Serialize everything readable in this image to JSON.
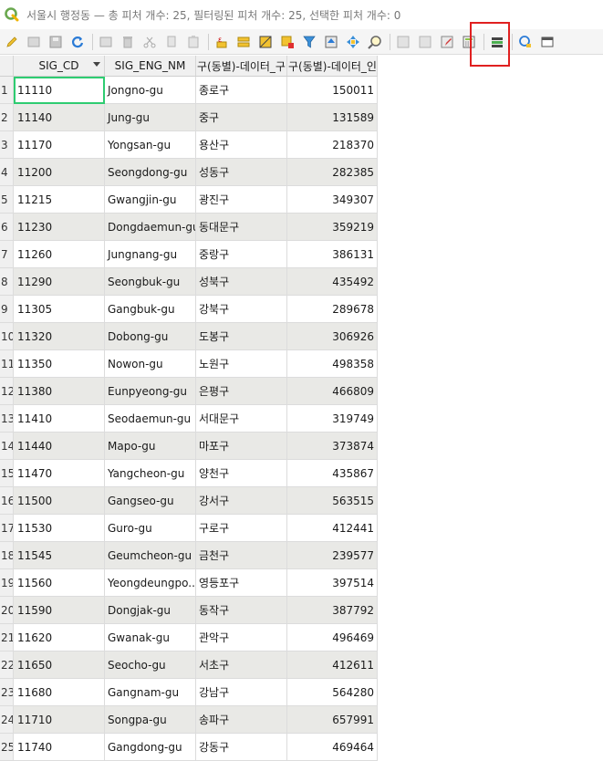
{
  "window": {
    "title": "서울시 행정동 — 총 피처 개수: 25, 필터링된 피처 개수: 25, 선택한 피처 개수: 0"
  },
  "toolbar": {
    "buttons": [
      {
        "name": "toggle-editing-button",
        "icon": "pencil-icon"
      },
      {
        "name": "multi-edit-button",
        "icon": "multi-edit-icon"
      },
      {
        "name": "save-edits-button",
        "icon": "save-icon"
      },
      {
        "name": "reload-button",
        "icon": "refresh-icon"
      },
      {
        "name": "add-feature-button",
        "icon": "add-feature-icon"
      },
      {
        "name": "delete-feature-button",
        "icon": "delete-icon"
      },
      {
        "name": "cut-button",
        "icon": "cut-icon"
      },
      {
        "name": "copy-button",
        "icon": "copy-icon"
      },
      {
        "name": "paste-button",
        "icon": "paste-icon"
      },
      {
        "name": "select-by-expression-button",
        "icon": "expression-select-icon"
      },
      {
        "name": "select-all-button",
        "icon": "select-all-icon"
      },
      {
        "name": "invert-selection-button",
        "icon": "invert-selection-icon"
      },
      {
        "name": "deselect-all-button",
        "icon": "deselect-icon"
      },
      {
        "name": "filter-select-button",
        "icon": "filter-icon"
      },
      {
        "name": "move-selection-top-button",
        "icon": "move-top-icon"
      },
      {
        "name": "pan-to-selection-button",
        "icon": "pan-icon"
      },
      {
        "name": "zoom-to-selection-button",
        "icon": "zoom-icon"
      },
      {
        "name": "new-field-button",
        "icon": "new-field-icon"
      },
      {
        "name": "delete-field-button",
        "icon": "delete-field-icon"
      },
      {
        "name": "organize-columns-button",
        "icon": "organize-columns-icon"
      },
      {
        "name": "field-calculator-button",
        "icon": "calculator-icon"
      },
      {
        "name": "conditional-formatting-button",
        "icon": "conditional-format-icon"
      },
      {
        "name": "actions-button",
        "icon": "actions-icon"
      },
      {
        "name": "dock-button",
        "icon": "dock-icon"
      }
    ],
    "highlight_color": "#e02020"
  },
  "table": {
    "columns": [
      "SIG_CD",
      "SIG_ENG_NM",
      "구(동별)-데이터_구",
      "구(동별)-데이터_인"
    ],
    "rows": [
      {
        "num": "1",
        "cd": "11110",
        "eng": "Jongno-gu",
        "kor": "종로구",
        "pop": "150011"
      },
      {
        "num": "2",
        "cd": "11140",
        "eng": "Jung-gu",
        "kor": "중구",
        "pop": "131589"
      },
      {
        "num": "3",
        "cd": "11170",
        "eng": "Yongsan-gu",
        "kor": "용산구",
        "pop": "218370"
      },
      {
        "num": "4",
        "cd": "11200",
        "eng": "Seongdong-gu",
        "kor": "성동구",
        "pop": "282385"
      },
      {
        "num": "5",
        "cd": "11215",
        "eng": "Gwangjin-gu",
        "kor": "광진구",
        "pop": "349307"
      },
      {
        "num": "6",
        "cd": "11230",
        "eng": "Dongdaemun-gu",
        "kor": "동대문구",
        "pop": "359219"
      },
      {
        "num": "7",
        "cd": "11260",
        "eng": "Jungnang-gu",
        "kor": "중랑구",
        "pop": "386131"
      },
      {
        "num": "8",
        "cd": "11290",
        "eng": "Seongbuk-gu",
        "kor": "성북구",
        "pop": "435492"
      },
      {
        "num": "9",
        "cd": "11305",
        "eng": "Gangbuk-gu",
        "kor": "강북구",
        "pop": "289678"
      },
      {
        "num": "10",
        "cd": "11320",
        "eng": "Dobong-gu",
        "kor": "도봉구",
        "pop": "306926"
      },
      {
        "num": "11",
        "cd": "11350",
        "eng": "Nowon-gu",
        "kor": "노원구",
        "pop": "498358"
      },
      {
        "num": "12",
        "cd": "11380",
        "eng": "Eunpyeong-gu",
        "kor": "은평구",
        "pop": "466809"
      },
      {
        "num": "13",
        "cd": "11410",
        "eng": "Seodaemun-gu",
        "kor": "서대문구",
        "pop": "319749"
      },
      {
        "num": "14",
        "cd": "11440",
        "eng": "Mapo-gu",
        "kor": "마포구",
        "pop": "373874"
      },
      {
        "num": "15",
        "cd": "11470",
        "eng": "Yangcheon-gu",
        "kor": "양천구",
        "pop": "435867"
      },
      {
        "num": "16",
        "cd": "11500",
        "eng": "Gangseo-gu",
        "kor": "강서구",
        "pop": "563515"
      },
      {
        "num": "17",
        "cd": "11530",
        "eng": "Guro-gu",
        "kor": "구로구",
        "pop": "412441"
      },
      {
        "num": "18",
        "cd": "11545",
        "eng": "Geumcheon-gu",
        "kor": "금천구",
        "pop": "239577"
      },
      {
        "num": "19",
        "cd": "11560",
        "eng": "Yeongdeungpo...",
        "kor": "영등포구",
        "pop": "397514"
      },
      {
        "num": "20",
        "cd": "11590",
        "eng": "Dongjak-gu",
        "kor": "동작구",
        "pop": "387792"
      },
      {
        "num": "21",
        "cd": "11620",
        "eng": "Gwanak-gu",
        "kor": "관악구",
        "pop": "496469"
      },
      {
        "num": "22",
        "cd": "11650",
        "eng": "Seocho-gu",
        "kor": "서초구",
        "pop": "412611"
      },
      {
        "num": "23",
        "cd": "11680",
        "eng": "Gangnam-gu",
        "kor": "강남구",
        "pop": "564280"
      },
      {
        "num": "24",
        "cd": "11710",
        "eng": "Songpa-gu",
        "kor": "송파구",
        "pop": "657991"
      },
      {
        "num": "25",
        "cd": "11740",
        "eng": "Gangdong-gu",
        "kor": "강동구",
        "pop": "469464"
      }
    ],
    "focus_color": "#2ecc71",
    "alt_row_color": "#e9e9e6"
  }
}
